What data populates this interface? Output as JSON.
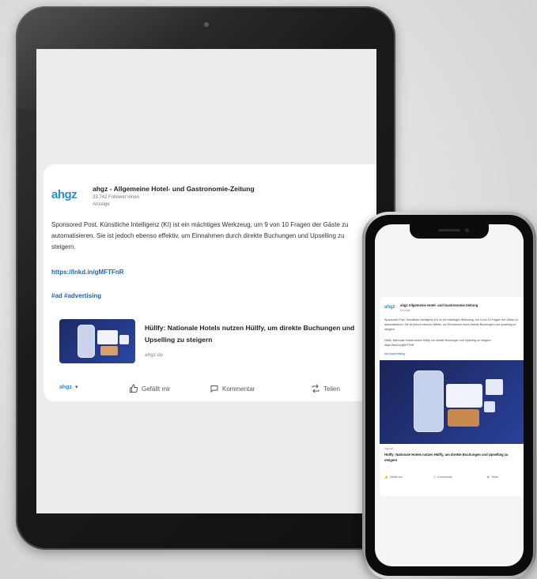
{
  "post": {
    "company_logo": "ahgz",
    "company_name": "ahgz - Allgemeine Hotel- und Gastronomie-Zeitung",
    "followers": "33.742 Follower:innen",
    "promoted": "Anzeige",
    "text": "Sponsored Post. Künstliche Intelligenz (KI) ist ein mächtiges Werkzeug, um 9 von 10 Fragen der Gäste zu automatisieren. Sie ist jedoch ebenso effektiv, um Einnahmen durch direkte Buchungen und Upselling zu steigern.",
    "link": "https://lnkd.in/gMFTFnR",
    "hashtag": "#ad #advertising",
    "article": {
      "title": "Hüllfy: Nationale Hotels nutzen Hüllfy, um direkte Buchungen und Upselling zu steigern",
      "source": "ahgz.de"
    },
    "actions": {
      "account": "ahgz",
      "like": "Gefällt mir",
      "comment": "Kommentar",
      "share": "Teilen"
    }
  },
  "phone_post": {
    "company_logo": "ahgz",
    "company_name": "ahgz Allgemeine Hotel- und Gastronomie-Zeitung",
    "sub": "Anzeige",
    "text": "Sponsored Post. Künstliche Intelligenz (KI) ist ein mächtiges Werkzeug, um 9 von 10 Fragen der Gäste zu automatisieren. Sie ist jedoch ebenso effektiv, um Einnahmen durch direkte Buchungen und Upselling zu steigern.",
    "link_text": "Hüllfy: Nationale Hotels nutzen Hüllfy, um direkte Buchungen und Upselling zu steigern. https://lnkd.in/gMFTFnR",
    "hashtag": "#ad #advertising",
    "source": "ahgz.de",
    "article_title": "Hüllfy: Nationale Hotels nutzen Hüllfy, um direkte Buchungen und Upselling zu steigern",
    "actions": {
      "like": "Gefällt mir",
      "comment": "Kommentar",
      "share": "Teilen"
    }
  },
  "colors": {
    "brand_blue": "#2a8fc9",
    "link_blue": "#1a66b5",
    "screen_bg": "#ececec"
  },
  "icons": [
    "thumbs-up-icon",
    "comment-icon",
    "share-icon",
    "chevron-down-icon"
  ]
}
